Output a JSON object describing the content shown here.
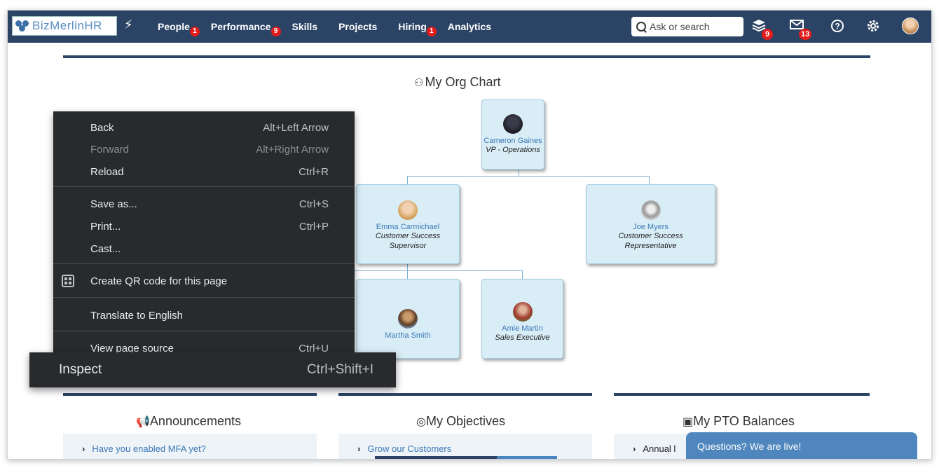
{
  "app": {
    "logo_text": "BizMerlinHR"
  },
  "nav": {
    "items": [
      {
        "label": "People",
        "badge": "1"
      },
      {
        "label": "Performance",
        "badge": "9"
      },
      {
        "label": "Skills",
        "badge": ""
      },
      {
        "label": "Projects",
        "badge": ""
      },
      {
        "label": "Hiring",
        "badge": "1"
      },
      {
        "label": "Analytics",
        "badge": ""
      }
    ],
    "search_placeholder": "Ask or search",
    "tasks_badge": "9",
    "messages_badge": "13"
  },
  "org_chart": {
    "title": "My Org Chart",
    "nodes": [
      {
        "name": "Cameron Gaines",
        "title": "VP - Operations"
      },
      {
        "name": "Emma Carmichael",
        "title": "Customer Success Supervisor"
      },
      {
        "name": "Joe Myers",
        "title": "Customer Success Representative"
      },
      {
        "name": "Martha Smith",
        "title": ""
      },
      {
        "name": "Amie Martin",
        "title": "Sales Executive"
      }
    ]
  },
  "panels": {
    "announcements": {
      "title": "Announcements",
      "item": "Have you enabled MFA yet?"
    },
    "objectives": {
      "title": "My Objectives",
      "item": "Grow our Customers",
      "progress_fraction": 0.67
    },
    "pto": {
      "title": "My PTO Balances",
      "item": "Annual l"
    }
  },
  "chat": {
    "label": "Questions? We are live!"
  },
  "context_menu": {
    "items": [
      {
        "label": "Back",
        "shortcut": "Alt+Left Arrow",
        "disabled": false
      },
      {
        "label": "Forward",
        "shortcut": "Alt+Right Arrow",
        "disabled": true
      },
      {
        "label": "Reload",
        "shortcut": "Ctrl+R",
        "disabled": false
      },
      {
        "label": "Save as...",
        "shortcut": "Ctrl+S",
        "disabled": false
      },
      {
        "label": "Print...",
        "shortcut": "Ctrl+P",
        "disabled": false
      },
      {
        "label": "Cast...",
        "shortcut": "",
        "disabled": false
      },
      {
        "label": "Create QR code for this page",
        "shortcut": "",
        "disabled": false
      },
      {
        "label": "Translate to English",
        "shortcut": "",
        "disabled": false
      },
      {
        "label": "View page source",
        "shortcut": "Ctrl+U",
        "disabled": false
      }
    ],
    "inspect": {
      "label": "Inspect",
      "shortcut": "Ctrl+Shift+I"
    }
  },
  "colors": {
    "nav_bg": "#2b4466",
    "badge": "#e21b1b",
    "node_bg": "#d9edf7",
    "link": "#3a78b5",
    "menu_bg": "#292a2d",
    "chat_bg": "#4f86bd"
  }
}
